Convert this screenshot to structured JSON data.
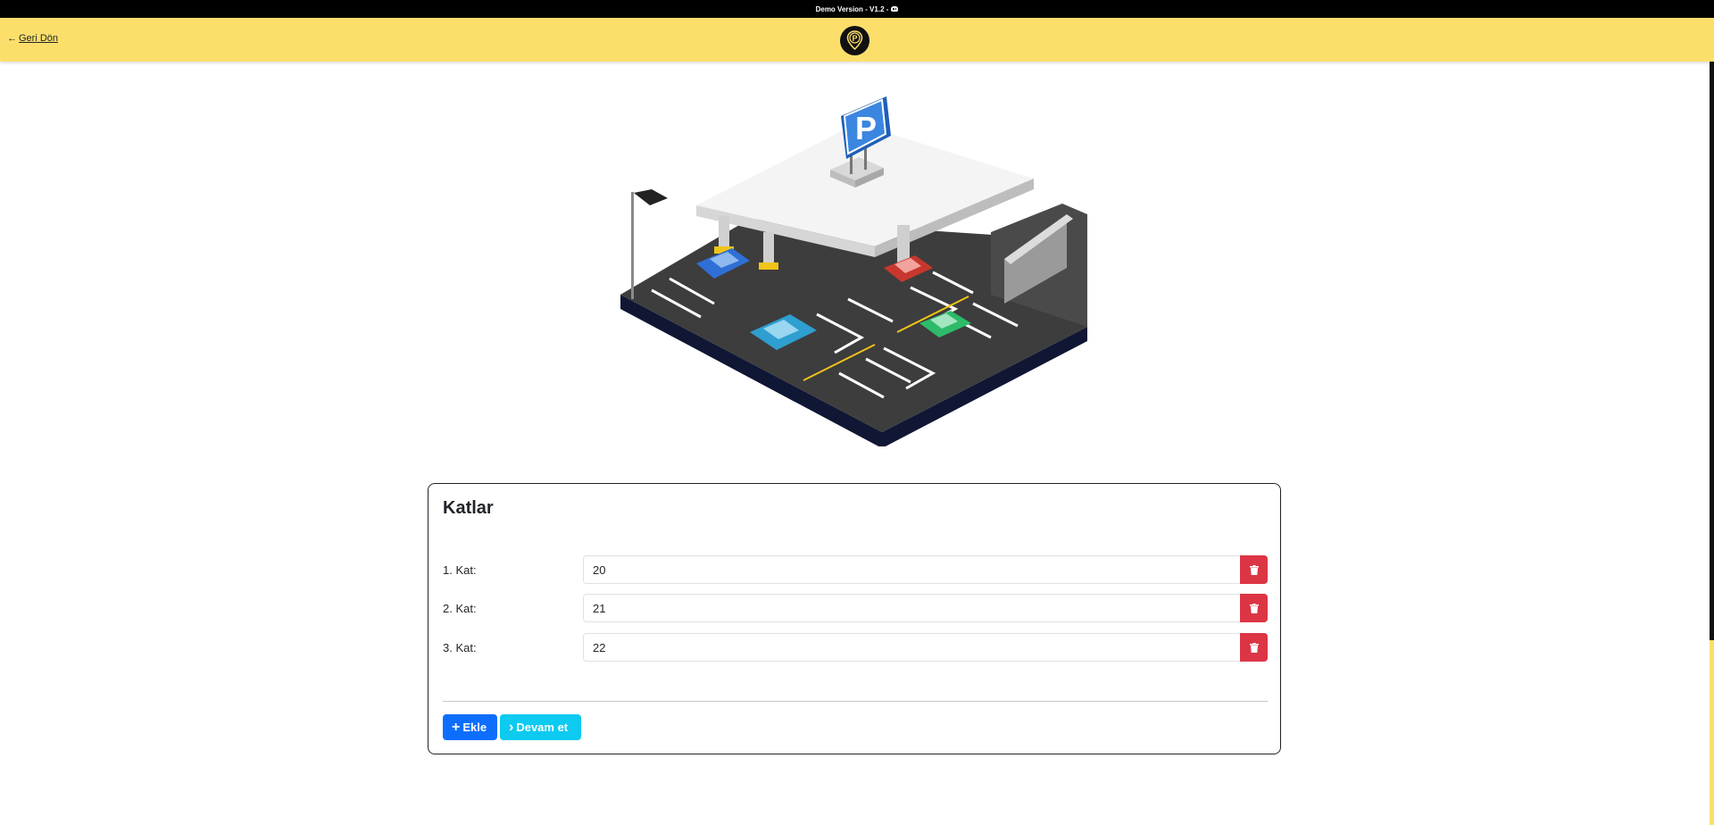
{
  "topbar": {
    "text": "Demo Version - V1.2 -",
    "icon": "discord-icon"
  },
  "navbar": {
    "back_arrow": "←",
    "back_label": "Geri Dön",
    "logo_letter": "P"
  },
  "illustration": {
    "sign_letter": "P"
  },
  "card": {
    "title": "Katlar",
    "floors": [
      {
        "label": "1. Kat:",
        "value": "20"
      },
      {
        "label": "2. Kat:",
        "value": "21"
      },
      {
        "label": "3. Kat:",
        "value": "22"
      }
    ],
    "add_button": {
      "icon": "+",
      "label": "Ekle"
    },
    "next_button": {
      "icon": "›",
      "label": "Devam et"
    }
  },
  "colors": {
    "navbar": "#fcdf6b",
    "danger": "#dc3545",
    "primary": "#0d6efd",
    "info": "#0dcaf0"
  }
}
